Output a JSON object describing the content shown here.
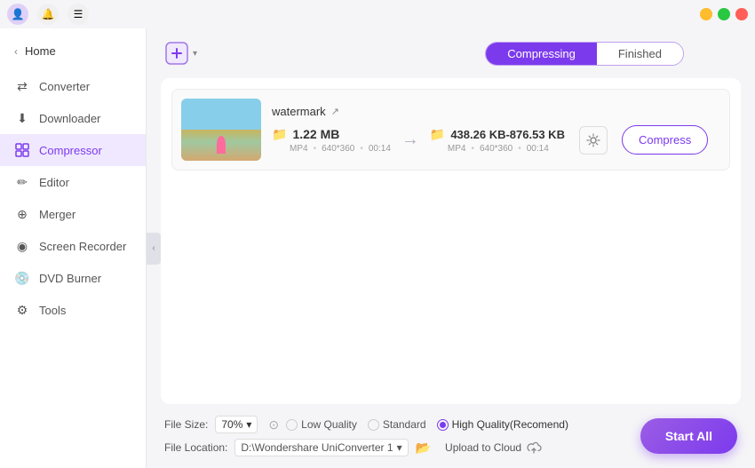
{
  "titleBar": {
    "icons": [
      "user-icon",
      "bell-icon"
    ],
    "controls": [
      "minimize",
      "maximize",
      "close"
    ]
  },
  "sidebar": {
    "homeLabel": "Home",
    "items": [
      {
        "id": "converter",
        "label": "Converter",
        "icon": "⇄"
      },
      {
        "id": "downloader",
        "label": "Downloader",
        "icon": "⬇"
      },
      {
        "id": "compressor",
        "label": "Compressor",
        "icon": "⊞",
        "active": true
      },
      {
        "id": "editor",
        "label": "Editor",
        "icon": "✏"
      },
      {
        "id": "merger",
        "label": "Merger",
        "icon": "⊕"
      },
      {
        "id": "screen-recorder",
        "label": "Screen Recorder",
        "icon": "◉"
      },
      {
        "id": "dvd-burner",
        "label": "DVD Burner",
        "icon": "💿"
      },
      {
        "id": "tools",
        "label": "Tools",
        "icon": "⚙"
      }
    ]
  },
  "tabs": [
    {
      "id": "compressing",
      "label": "Compressing",
      "active": true
    },
    {
      "id": "finished",
      "label": "Finished",
      "active": false
    }
  ],
  "fileCard": {
    "name": "watermark",
    "originalSize": "1.22 MB",
    "originalFormat": "MP4",
    "originalResolution": "640*360",
    "originalDuration": "00:14",
    "compressedSize": "438.26 KB-876.53 KB",
    "compressedFormat": "MP4",
    "compressedResolution": "640*360",
    "compressedDuration": "00:14",
    "compressBtn": "Compress"
  },
  "bottomBar": {
    "fileSizeLabel": "File Size:",
    "fileSizeValue": "70%",
    "qualityOptions": [
      {
        "label": "Low Quality",
        "selected": false
      },
      {
        "label": "Standard",
        "selected": false
      },
      {
        "label": "High Quality(Recomend)",
        "selected": true
      }
    ],
    "fileLocationLabel": "File Location:",
    "fileLocationPath": "D:\\Wondershare UniConverter 1",
    "uploadCloudLabel": "Upload to Cloud",
    "startAllBtn": "Start All"
  }
}
